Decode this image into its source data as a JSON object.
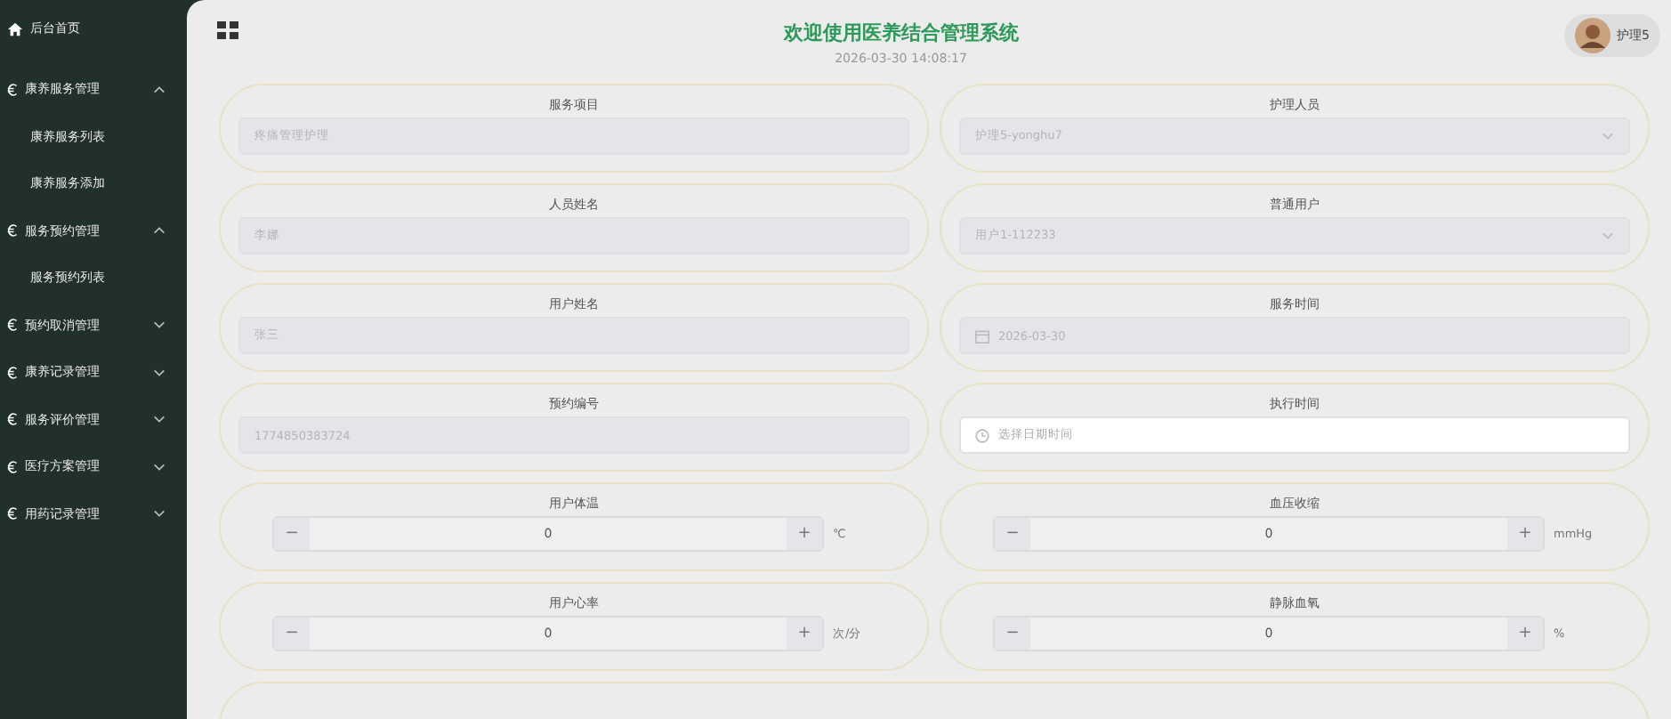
{
  "sidebar": {
    "home": "后台首页",
    "menus": [
      {
        "label": "康养服务管理",
        "expanded": true,
        "children": [
          "康养服务列表",
          "康养服务添加"
        ]
      },
      {
        "label": "服务预约管理",
        "expanded": true,
        "children": [
          "服务预约列表"
        ]
      },
      {
        "label": "预约取消管理",
        "expanded": false
      },
      {
        "label": "康养记录管理",
        "expanded": false
      },
      {
        "label": "服务评价管理",
        "expanded": false
      },
      {
        "label": "医疗方案管理",
        "expanded": false
      },
      {
        "label": "用药记录管理",
        "expanded": false
      }
    ]
  },
  "header": {
    "title": "欢迎使用医养结合管理系统",
    "datetime": "2026-03-30 14:08:17",
    "user": "护理5"
  },
  "form": [
    {
      "label": "服务项目",
      "kind": "text",
      "value": "疼痛管理护理",
      "disabled": true
    },
    {
      "label": "护理人员",
      "kind": "select",
      "value": "护理5-yonghu7",
      "disabled": true
    },
    {
      "label": "人员姓名",
      "kind": "text",
      "value": "李娜",
      "disabled": true
    },
    {
      "label": "普通用户",
      "kind": "select",
      "value": "用户1-112233",
      "disabled": true
    },
    {
      "label": "用户姓名",
      "kind": "text",
      "value": "张三",
      "disabled": true
    },
    {
      "label": "服务时间",
      "kind": "date",
      "value": "2026-03-30",
      "disabled": true
    },
    {
      "label": "预约编号",
      "kind": "text",
      "value": "1774850383724",
      "disabled": true
    },
    {
      "label": "执行时间",
      "kind": "datetime",
      "placeholder": "选择日期时间",
      "disabled": false
    },
    {
      "label": "用户体温",
      "kind": "number",
      "value": "0",
      "unit": "℃",
      "minus": "−",
      "plus": "+"
    },
    {
      "label": "血压收缩",
      "kind": "number",
      "value": "0",
      "unit": "mmHg",
      "minus": "−",
      "plus": "+"
    },
    {
      "label": "用户心率",
      "kind": "number",
      "value": "0",
      "unit": "次/分",
      "minus": "−",
      "plus": "+"
    },
    {
      "label": "静脉血氧",
      "kind": "number",
      "value": "0",
      "unit": "%",
      "minus": "−",
      "plus": "+"
    },
    {
      "kind": "partial"
    }
  ]
}
